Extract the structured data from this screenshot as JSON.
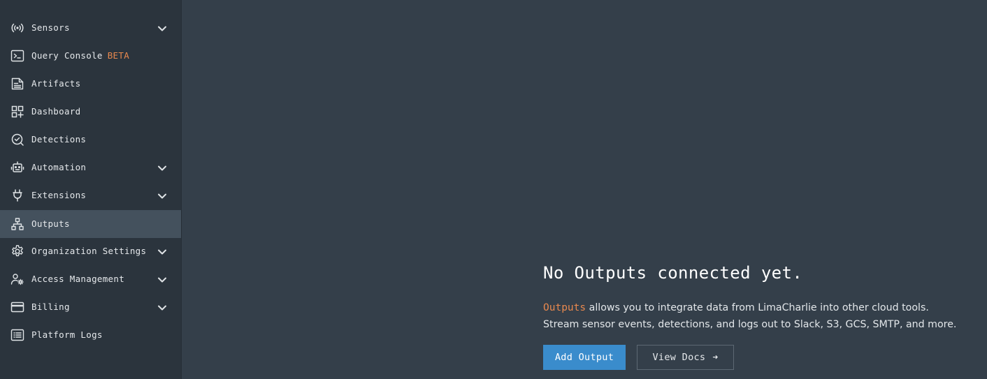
{
  "sidebar": {
    "items": [
      {
        "label": "Sensors",
        "icon": "broadcast-icon",
        "expandable": true
      },
      {
        "label": "Query Console",
        "badge": "BETA",
        "icon": "terminal-icon",
        "expandable": false
      },
      {
        "label": "Artifacts",
        "icon": "document-icon",
        "expandable": false
      },
      {
        "label": "Dashboard",
        "icon": "dashboard-grid-icon",
        "expandable": false
      },
      {
        "label": "Detections",
        "icon": "check-circle-search-icon",
        "expandable": false
      },
      {
        "label": "Automation",
        "icon": "robot-icon",
        "expandable": true
      },
      {
        "label": "Extensions",
        "icon": "plug-icon",
        "expandable": true
      },
      {
        "label": "Outputs",
        "icon": "hierarchy-icon",
        "expandable": false,
        "active": true
      },
      {
        "label": "Organization Settings",
        "icon": "gear-icon",
        "expandable": true
      },
      {
        "label": "Access Management",
        "icon": "user-gear-icon",
        "expandable": true
      },
      {
        "label": "Billing",
        "icon": "credit-card-icon",
        "expandable": true
      },
      {
        "label": "Platform Logs",
        "icon": "list-icon",
        "expandable": false
      }
    ]
  },
  "main": {
    "title": "No Outputs connected yet.",
    "description_keyword": "Outputs",
    "description_line1": " allows you to integrate data from LimaCharlie into other cloud tools.",
    "description_line2": "Stream sensor events, detections, and logs out to Slack, S3, GCS, SMTP, and more.",
    "primary_button": "Add Output",
    "secondary_button": "View Docs",
    "secondary_button_icon": "arrow-right-icon"
  },
  "colors": {
    "sidebar_bg": "#2b343d",
    "main_bg": "#343f4a",
    "active_item_bg": "#44515d",
    "accent_orange": "#e8884e",
    "primary_button": "#3a8ccc"
  }
}
